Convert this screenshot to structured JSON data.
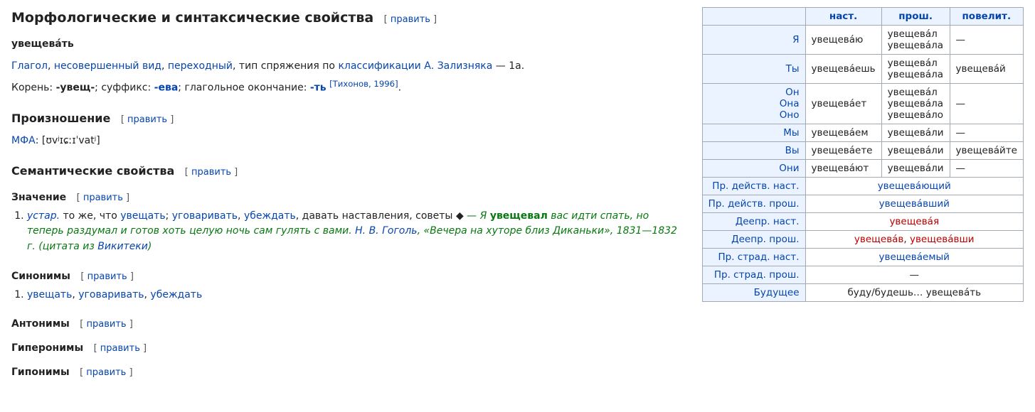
{
  "edit_label": "править",
  "sections": {
    "morph": "Морфологические и синтаксические свойства",
    "pron": "Произношение",
    "sem": "Семантические свойства",
    "meaning": "Значение",
    "syn": "Синонимы",
    "ant": "Антонимы",
    "hyper": "Гиперонимы",
    "hypo": "Гипонимы"
  },
  "headword": "увещева́ть",
  "pos_line": {
    "verb": "Глагол",
    "aspect": "несовершенный вид",
    "trans": "переходный",
    "mid": ", тип спряжения по ",
    "classif": "классификации А. Зализняка",
    "tail": " — 1a."
  },
  "morph_line": {
    "pre_root": "Корень: ",
    "root": "-увещ-",
    "pre_suffix": "; суффикс: ",
    "suffix": "-ева",
    "pre_ending": "; глагольное окончание: ",
    "ending": "-ть",
    "ref": "[Тихонов, 1996]",
    "period": "."
  },
  "pron": {
    "mfa_label": "МФА",
    "ipa": ": [ʊvʲɪɕːɪˈvatʲ]"
  },
  "meaning": {
    "qual": "устар.",
    "pre": " то же, что ",
    "syn1": "увещать",
    "syn2": "уговаривать",
    "syn3": "убеждать",
    "tail": ", давать наставления, советы ",
    "diamond": "◆",
    "quote_pre": " — Я ",
    "bold": "увещевал",
    "quote_post": " вас идти спать, но теперь раздумал и готов хоть целую ночь сам гулять с вами.",
    "author": "Н. В. Гоголь",
    "work": ", «Вечера на хуторе близ Диканьки», 1831—1832 г. ",
    "cit_open": "(цитата из ",
    "wikiteka": "Викитеки",
    "cit_close": ")"
  },
  "synonyms": {
    "s1": "увещать",
    "s2": "уговаривать",
    "s3": "убеждать"
  },
  "conj": {
    "head": {
      "blank": "",
      "present": "наст.",
      "past": "прош.",
      "imper": "повелит."
    },
    "rows": {
      "ya": {
        "label": "Я",
        "pres": "увещева́ю",
        "past1": "увещева́л",
        "past2": "увещева́ла",
        "imp": "—"
      },
      "ty": {
        "label": "Ты",
        "pres": "увещева́ешь",
        "past1": "увещева́л",
        "past2": "увещева́ла",
        "imp": "увещева́й"
      },
      "on": {
        "l1": "Он",
        "l2": "Она",
        "l3": "Оно",
        "pres": "увещева́ет",
        "past1": "увещева́л",
        "past2": "увещева́ла",
        "past3": "увещева́ло",
        "imp": "—"
      },
      "my": {
        "label": "Мы",
        "pres": "увещева́ем",
        "past": "увещева́ли",
        "imp": "—"
      },
      "vy": {
        "label": "Вы",
        "pres": "увещева́ете",
        "past": "увещева́ли",
        "imp": "увещева́йте"
      },
      "oni": {
        "label": "Они",
        "pres": "увещева́ют",
        "past": "увещева́ли",
        "imp": "—"
      }
    },
    "extra": {
      "prd_nast": {
        "label": "Пр. действ. наст.",
        "val": "увещева́ющий"
      },
      "prd_prosh": {
        "label": "Пр. действ. прош.",
        "val": "увещева́вший"
      },
      "deepr_nast": {
        "label": "Деепр. наст.",
        "val": "увещева́я"
      },
      "deepr_prosh": {
        "label": "Деепр. прош.",
        "v1": "увещева́в",
        "v2": "увещева́вши"
      },
      "prstrad_nast": {
        "label": "Пр. страд. наст.",
        "val": "увещева́емый"
      },
      "prstrad_prosh": {
        "label": "Пр. страд. прош.",
        "val": "—"
      },
      "future": {
        "label": "Будущее",
        "val": "буду/будешь… увещева́ть"
      }
    }
  }
}
